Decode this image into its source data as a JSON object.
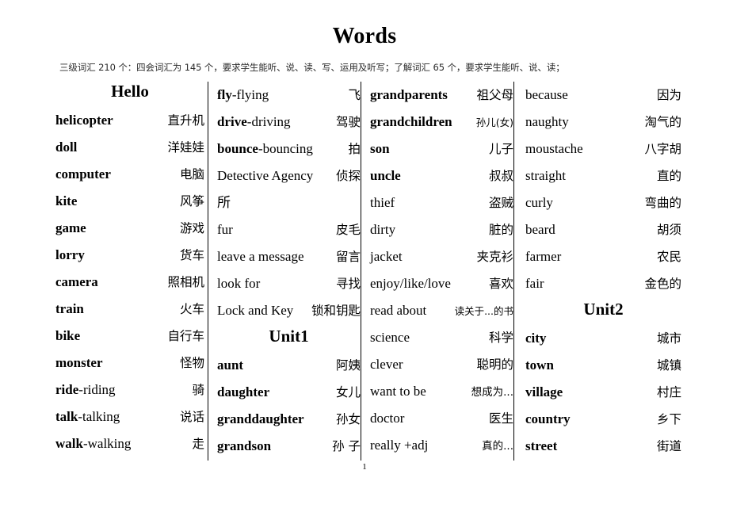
{
  "document": {
    "title": "Words",
    "intro": "三级词汇 210 个：四会词汇为 145 个，要求学生能听、说、读、写、运用及听写；了解词汇 65 个，要求学生能听、说、读；",
    "page_number": "1"
  },
  "columns": [
    {
      "heading": "Hello",
      "entries": [
        {
          "en": "helicopter",
          "bold": true,
          "zh": "直升机"
        },
        {
          "en": "doll",
          "bold": true,
          "zh": "洋娃娃"
        },
        {
          "en": "computer",
          "bold": true,
          "zh": "电脑"
        },
        {
          "en": "kite",
          "bold": true,
          "zh": "风筝"
        },
        {
          "en": "game",
          "bold": true,
          "zh": "游戏"
        },
        {
          "en": "lorry",
          "bold": true,
          "zh": "货车"
        },
        {
          "en": "camera",
          "bold": true,
          "zh": "照相机"
        },
        {
          "en": "train",
          "bold": true,
          "zh": "火车"
        },
        {
          "en": "bike",
          "bold": true,
          "zh": "自行车"
        },
        {
          "en": "monster",
          "bold": true,
          "zh": "怪物"
        },
        {
          "en": "ride",
          "suffix": "-riding",
          "bold": true,
          "zh": "骑"
        },
        {
          "en": "talk",
          "suffix": "-talking",
          "bold": true,
          "zh": "说话"
        },
        {
          "en": "walk",
          "suffix": "-walking",
          "bold": true,
          "zh": "走"
        }
      ]
    },
    {
      "heading": "Unit1",
      "heading_index": 8,
      "entries": [
        {
          "en": "fly",
          "suffix": "-flying",
          "bold": true,
          "zh": "飞"
        },
        {
          "en": "drive",
          "suffix": "-driving",
          "bold": true,
          "zh": "驾驶"
        },
        {
          "en": "bounce",
          "suffix": "-bouncing",
          "bold": true,
          "zh": "拍"
        },
        {
          "en": "Detective Agency",
          "bold": false,
          "zh": "侦探",
          "cont": "所"
        },
        {
          "en": "fur",
          "bold": false,
          "zh": "皮毛"
        },
        {
          "en": "leave a message",
          "bold": false,
          "zh": "留言"
        },
        {
          "en": "look for",
          "bold": false,
          "zh": "寻找"
        },
        {
          "en": "Lock and Key",
          "bold": false,
          "zh": "锁和钥匙"
        },
        {
          "en": "aunt",
          "bold": true,
          "zh": "阿姨"
        },
        {
          "en": "daughter",
          "bold": true,
          "zh": "女儿"
        },
        {
          "en": "granddaughter",
          "bold": true,
          "zh": "孙女"
        },
        {
          "en": "grandson",
          "bold": true,
          "zh": "孙 子"
        }
      ]
    },
    {
      "heading": null,
      "entries": [
        {
          "en": "grandparents",
          "bold": true,
          "zh": "祖父母"
        },
        {
          "en": "grandchildren",
          "bold": true,
          "zh": "孙儿(女)",
          "zh_size": "small"
        },
        {
          "en": "son",
          "bold": true,
          "zh": "儿子"
        },
        {
          "en": "uncle",
          "bold": true,
          "zh": "叔叔"
        },
        {
          "en": "thief",
          "bold": false,
          "zh": "盗贼"
        },
        {
          "en": "dirty",
          "bold": false,
          "zh": "脏的"
        },
        {
          "en": "jacket",
          "bold": false,
          "zh": "夹克衫"
        },
        {
          "en": "enjoy/like/love",
          "bold": false,
          "zh": "喜欢"
        },
        {
          "en": "read about",
          "bold": false,
          "zh": "读关于...的书",
          "zh_size": "small"
        },
        {
          "en": "science",
          "bold": false,
          "zh": "科学"
        },
        {
          "en": "clever",
          "bold": false,
          "zh": "聪明的"
        },
        {
          "en": "want to be",
          "bold": false,
          "zh": "想成为...",
          "zh_size": "mid"
        },
        {
          "en": "doctor",
          "bold": false,
          "zh": "医生"
        },
        {
          "en": "really +adj",
          "bold": false,
          "zh": "真的...",
          "zh_size": "mid"
        }
      ]
    },
    {
      "heading": "Unit2",
      "heading_index": 8,
      "entries": [
        {
          "en": "because",
          "bold": false,
          "zh": "因为"
        },
        {
          "en": "naughty",
          "bold": false,
          "zh": "淘气的"
        },
        {
          "en": "moustache",
          "bold": false,
          "zh": "八字胡"
        },
        {
          "en": "straight",
          "bold": false,
          "zh": "直的"
        },
        {
          "en": "curly",
          "bold": false,
          "zh": "弯曲的"
        },
        {
          "en": "beard",
          "bold": false,
          "zh": "胡须"
        },
        {
          "en": "farmer",
          "bold": false,
          "zh": "农民"
        },
        {
          "en": "fair",
          "bold": false,
          "zh": "金色的"
        },
        {
          "en": "city",
          "bold": true,
          "zh": "城市"
        },
        {
          "en": "town",
          "bold": true,
          "zh": "城镇"
        },
        {
          "en": "village",
          "bold": true,
          "zh": "村庄"
        },
        {
          "en": "country",
          "bold": true,
          "zh": "乡下"
        },
        {
          "en": "street",
          "bold": true,
          "zh": "街道"
        }
      ]
    }
  ]
}
